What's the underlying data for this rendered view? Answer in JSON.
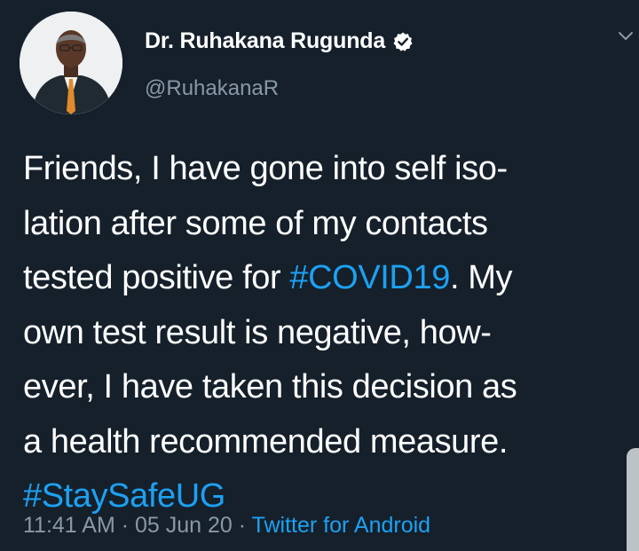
{
  "author": {
    "name": "Dr. Ruhakana Rugunda",
    "handle": "@RuhakanaR",
    "verified_icon": "verified-badge-icon",
    "avatar_icon": "profile-photo"
  },
  "tweet": {
    "lines": [
      [
        {
          "text": "Friends, I have gone into self iso-"
        }
      ],
      [
        {
          "text": "lation after some of my contacts"
        }
      ],
      [
        {
          "text": "tested positive for "
        },
        {
          "text": "#COVID19",
          "hashtag": true
        },
        {
          "text": ". My"
        }
      ],
      [
        {
          "text": "own test result is negative, how-"
        }
      ],
      [
        {
          "text": "ever, I have taken this decision as"
        }
      ],
      [
        {
          "text": "a health recommended measure."
        }
      ],
      [
        {
          "text": "#StaySafeUG",
          "hashtag": true
        }
      ]
    ]
  },
  "meta": {
    "time": "11:41 AM",
    "separator": " · ",
    "date": "05 Jun 20",
    "source": "Twitter for Android"
  },
  "colors": {
    "background": "#15202b",
    "text": "#ffffff",
    "secondary": "#8899a6",
    "link": "#1da1f2"
  }
}
